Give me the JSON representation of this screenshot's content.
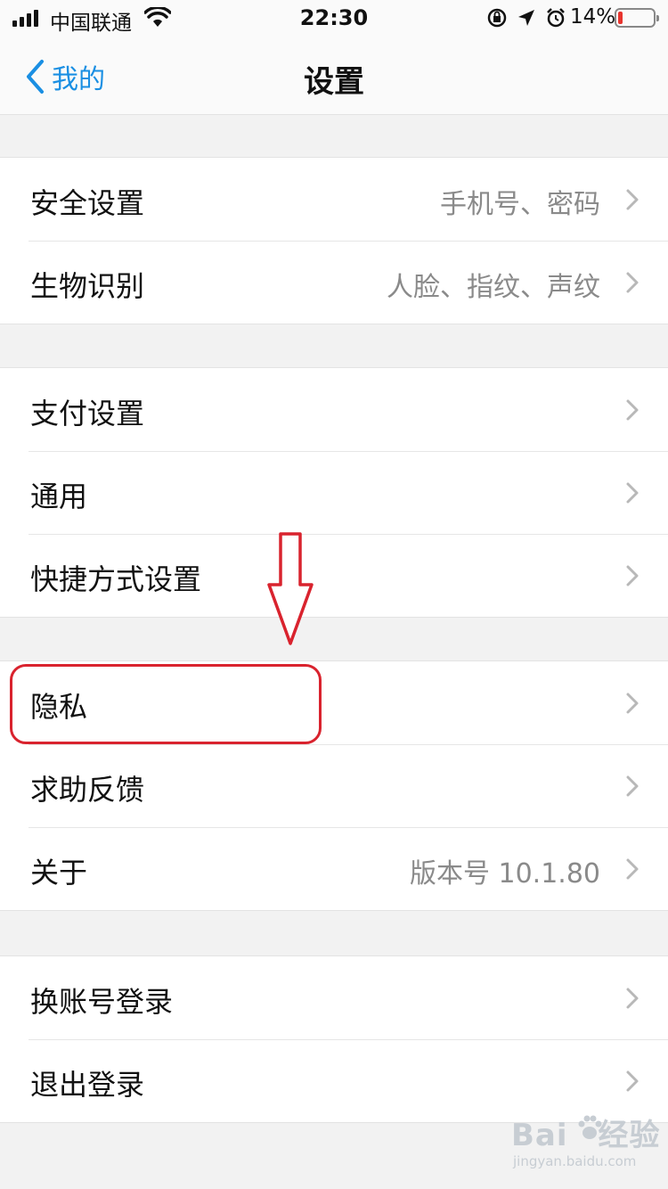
{
  "status_bar": {
    "carrier": "中国联通",
    "time": "22:30",
    "battery_percent": "14%",
    "battery_level": 0.14,
    "battery_color": "#e8342e",
    "icons": [
      "signal-icon",
      "wifi-icon",
      "orientation-lock-icon",
      "location-icon",
      "alarm-icon",
      "battery-icon"
    ]
  },
  "nav": {
    "back_label": "我的",
    "title": "设置",
    "accent": "#1a8fe3"
  },
  "groups": [
    {
      "items": [
        {
          "label": "安全设置",
          "detail": "手机号、密码"
        },
        {
          "label": "生物识别",
          "detail": "人脸、指纹、声纹"
        }
      ]
    },
    {
      "items": [
        {
          "label": "支付设置",
          "detail": ""
        },
        {
          "label": "通用",
          "detail": ""
        },
        {
          "label": "快捷方式设置",
          "detail": ""
        }
      ]
    },
    {
      "items": [
        {
          "label": "隐私",
          "detail": ""
        },
        {
          "label": "求助反馈",
          "detail": ""
        },
        {
          "label": "关于",
          "detail": "版本号 10.1.80"
        }
      ]
    },
    {
      "items": [
        {
          "label": "换账号登录",
          "detail": ""
        },
        {
          "label": "退出登录",
          "detail": ""
        }
      ]
    }
  ],
  "annotation": {
    "highlighted_item": "隐私",
    "color": "#d9232e"
  },
  "watermark": {
    "brand": "Bai",
    "brand_suffix": "经验",
    "url": "jingyan.baidu.com"
  }
}
